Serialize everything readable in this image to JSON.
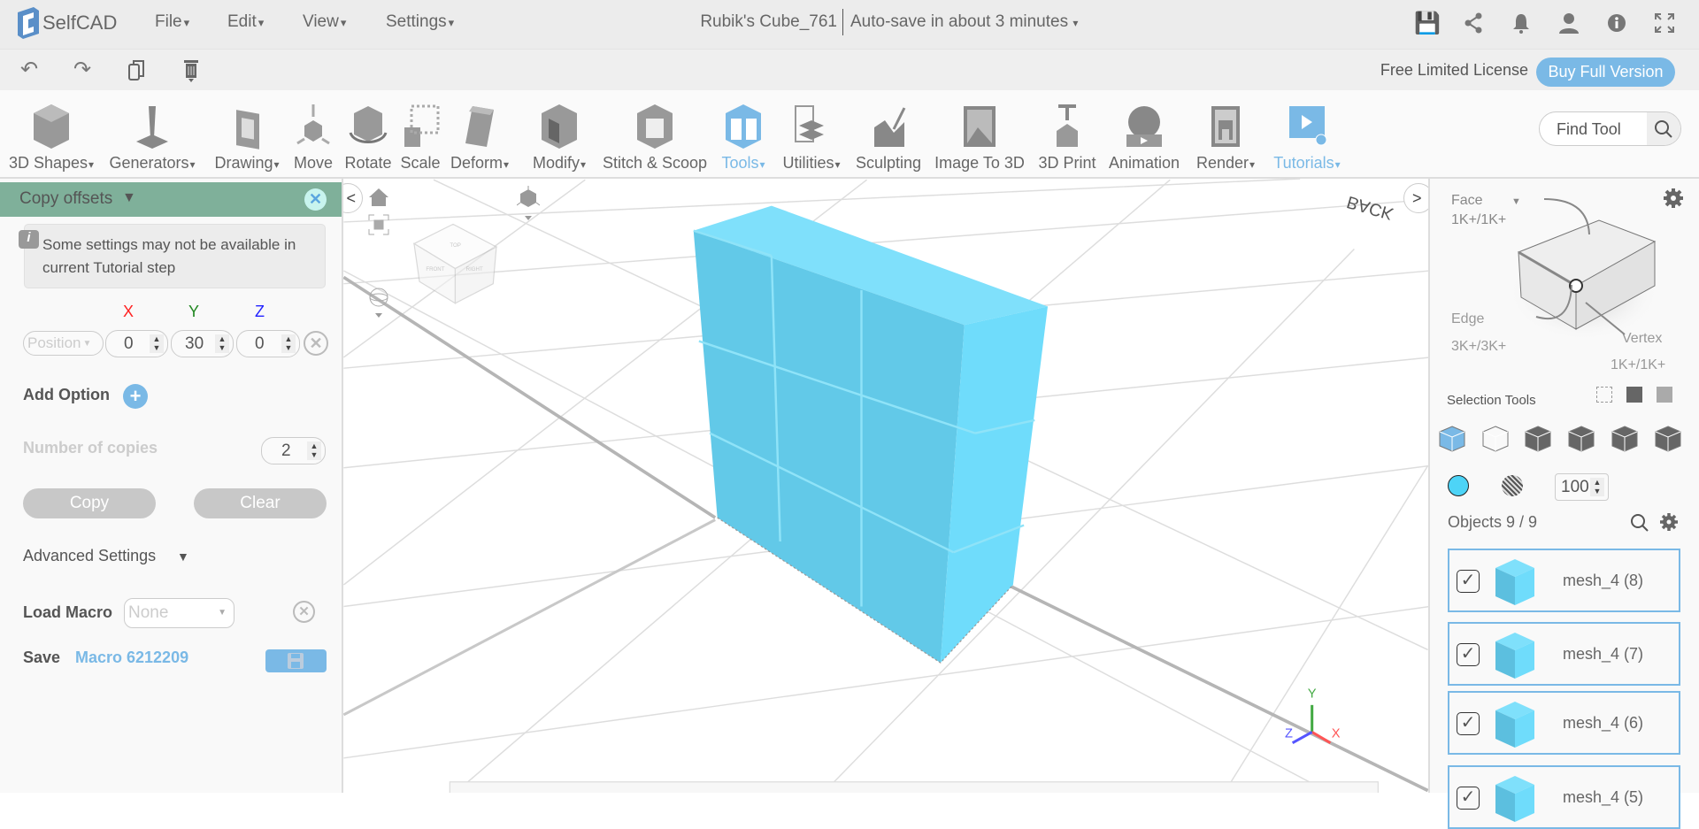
{
  "app": {
    "logo": "SelfCAD",
    "title": "Rubik's Cube_761",
    "autosave": "Auto-save in about 3 minutes"
  },
  "menu": [
    "File",
    "Edit",
    "View",
    "Settings"
  ],
  "top_icons": [
    "save-icon",
    "share-icon",
    "bell-icon",
    "user-icon",
    "info-icon",
    "fullscreen-icon"
  ],
  "edit_icons": [
    "undo-icon",
    "redo-icon",
    "copy-icon",
    "delete-icon"
  ],
  "license": {
    "text": "Free Limited License",
    "buy": "Buy Full Version"
  },
  "tools": [
    {
      "label": "3D Shapes",
      "dropdown": true
    },
    {
      "label": "Generators",
      "dropdown": true
    },
    {
      "label": "Drawing",
      "dropdown": true
    },
    {
      "label": "Move"
    },
    {
      "label": "Rotate"
    },
    {
      "label": "Scale"
    },
    {
      "label": "Deform",
      "dropdown": true
    },
    {
      "label": "Modify",
      "dropdown": true
    },
    {
      "label": "Stitch & Scoop"
    },
    {
      "label": "Tools",
      "dropdown": true,
      "active": true
    },
    {
      "label": "Utilities",
      "dropdown": true
    },
    {
      "label": "Sculpting"
    },
    {
      "label": "Image To 3D"
    },
    {
      "label": "3D Print"
    },
    {
      "label": "Animation"
    },
    {
      "label": "Render",
      "dropdown": true
    },
    {
      "label": "Tutorials",
      "dropdown": true,
      "active": true
    }
  ],
  "find_tool": {
    "placeholder": "Find Tool"
  },
  "panel": {
    "title": "Copy offsets",
    "info": "Some settings may not be available in current Tutorial step",
    "axes": {
      "x": "X",
      "y": "Y",
      "z": "Z"
    },
    "mode": "Position",
    "values": {
      "x": "0",
      "y": "30",
      "z": "0"
    },
    "add_option": "Add Option",
    "copies_label": "Number of copies",
    "copies": "2",
    "copy": "Copy",
    "clear": "Clear",
    "advanced": "Advanced Settings",
    "load_macro": "Load Macro",
    "macro_select": "None",
    "save": "Save",
    "macro_name": "Macro 6212209"
  },
  "viewport": {
    "view_cube": {
      "front": "FRONT",
      "right": "RIGHT",
      "top": "TOP"
    },
    "back_label": "BACK",
    "gizmo": {
      "x": "X",
      "y": "Y",
      "z": "Z"
    }
  },
  "colors": {
    "accent": "#7ab9e6",
    "panel_header": "#7fb09a",
    "mesh": "#6fd4f2",
    "color_swatch": "#4dd4f7",
    "x": "#ff5555",
    "y": "#44aa44",
    "z": "#5555ff"
  },
  "selection": {
    "face": "Face",
    "face_count": "1K+/1K+",
    "edge": "Edge",
    "edge_count": "3K+/3K+",
    "vertex": "Vertex",
    "vertex_count": "1K+/1K+",
    "tools_label": "Selection Tools",
    "opacity": "100"
  },
  "objects": {
    "label": "Objects 9 / 9",
    "items": [
      {
        "name": "mesh_4 (8)",
        "checked": true
      },
      {
        "name": "mesh_4 (7)",
        "checked": true
      },
      {
        "name": "mesh_4 (6)",
        "checked": true
      },
      {
        "name": "mesh_4 (5)",
        "checked": true
      }
    ]
  }
}
